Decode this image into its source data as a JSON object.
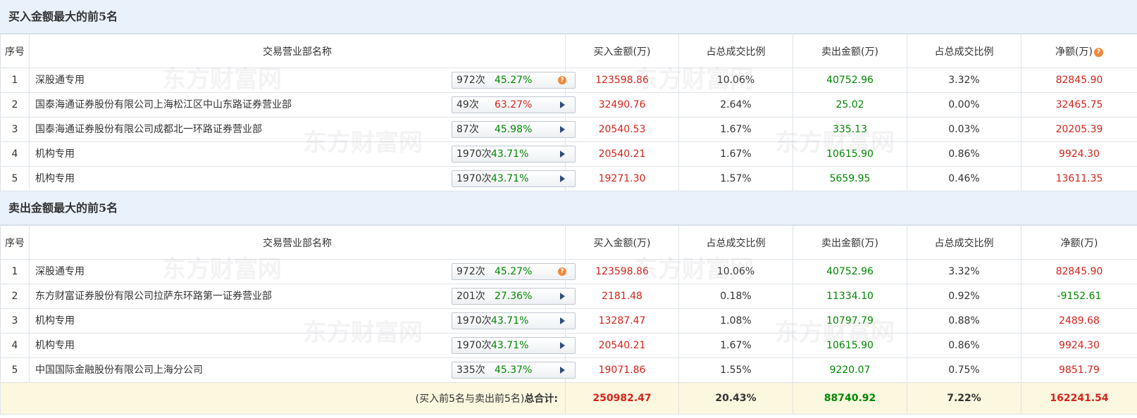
{
  "buy_section": {
    "title": "买入金额最大的前5名",
    "headers": [
      "序号",
      "交易营业部名称",
      "买入金额(万)",
      "占总成交比例",
      "卖出金额(万)",
      "占总成交比例",
      "净额(万)"
    ],
    "rows": [
      {
        "idx": "1",
        "name": "深股通专用",
        "times": "972次",
        "pct": "45.27%",
        "buy": "123598.86",
        "buy_ratio": "10.06%",
        "sell": "40752.96",
        "sell_ratio": "3.32%",
        "net": "82845.90"
      },
      {
        "idx": "2",
        "name": "国泰海通证券股份有限公司上海松江区中山东路证券营业部",
        "times": "49次",
        "pct": "63.27%",
        "buy": "32490.76",
        "buy_ratio": "2.64%",
        "sell": "25.02",
        "sell_ratio": "0.00%",
        "net": "32465.75"
      },
      {
        "idx": "3",
        "name": "国泰海通证券股份有限公司成都北一环路证券营业部",
        "times": "87次",
        "pct": "45.98%",
        "buy": "20540.53",
        "buy_ratio": "1.67%",
        "sell": "335.13",
        "sell_ratio": "0.03%",
        "net": "20205.39"
      },
      {
        "idx": "4",
        "name": "机构专用",
        "times": "1970次",
        "pct": "43.71%",
        "buy": "20540.21",
        "buy_ratio": "1.67%",
        "sell": "10615.90",
        "sell_ratio": "0.86%",
        "net": "9924.30"
      },
      {
        "idx": "5",
        "name": "机构专用",
        "times": "1970次",
        "pct": "43.71%",
        "buy": "19271.30",
        "buy_ratio": "1.57%",
        "sell": "5659.95",
        "sell_ratio": "0.46%",
        "net": "13611.35"
      }
    ]
  },
  "sell_section": {
    "title": "卖出金额最大的前5名",
    "headers": [
      "序号",
      "交易营业部名称",
      "买入金额(万)",
      "占总成交比例",
      "卖出金额(万)",
      "占总成交比例",
      "净额(万)"
    ],
    "rows": [
      {
        "idx": "1",
        "name": "深股通专用",
        "times": "972次",
        "pct": "45.27%",
        "buy": "123598.86",
        "buy_ratio": "10.06%",
        "sell": "40752.96",
        "sell_ratio": "3.32%",
        "net": "82845.90"
      },
      {
        "idx": "2",
        "name": "东方财富证券股份有限公司拉萨东环路第一证券营业部",
        "times": "201次",
        "pct": "27.36%",
        "buy": "2181.48",
        "buy_ratio": "0.18%",
        "sell": "11334.10",
        "sell_ratio": "0.92%",
        "net": "-9152.61"
      },
      {
        "idx": "3",
        "name": "机构专用",
        "times": "1970次",
        "pct": "43.71%",
        "buy": "13287.47",
        "buy_ratio": "1.08%",
        "sell": "10797.79",
        "sell_ratio": "0.88%",
        "net": "2489.68"
      },
      {
        "idx": "4",
        "name": "机构专用",
        "times": "1970次",
        "pct": "43.71%",
        "buy": "20540.21",
        "buy_ratio": "1.67%",
        "sell": "10615.90",
        "sell_ratio": "0.86%",
        "net": "9924.30"
      },
      {
        "idx": "5",
        "name": "中国国际金融股份有限公司上海分公司",
        "times": "335次",
        "pct": "45.37%",
        "buy": "19071.86",
        "buy_ratio": "1.55%",
        "sell": "9220.07",
        "sell_ratio": "0.75%",
        "net": "9851.79"
      }
    ]
  },
  "total": {
    "label_prefix": "(买入前5名与卖出前5名)",
    "label_bold": "总合计:",
    "buy": "250982.47",
    "buy_ratio": "20.43%",
    "sell": "88740.92",
    "sell_ratio": "7.22%",
    "net": "162241.54"
  },
  "watermark_text": "东方财富网",
  "colors": {
    "red": "#d4231a",
    "green": "#008800",
    "title_bg": "#e9f1fa",
    "total_bg": "#fcf7df",
    "help_icon": "#f08a3a"
  },
  "icons": {
    "help": "question-circle-icon",
    "expand": "triangle-right-icon"
  }
}
